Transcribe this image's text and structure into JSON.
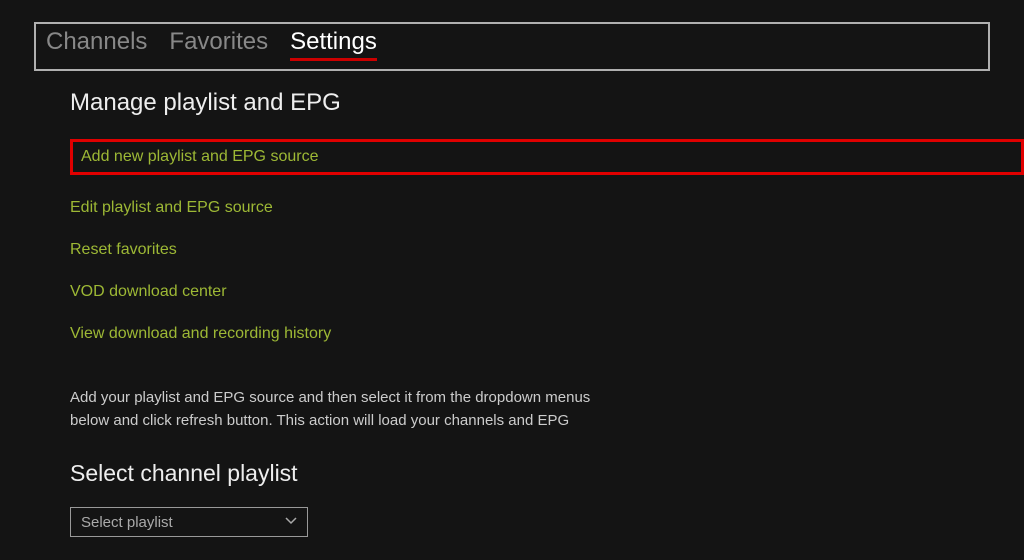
{
  "tabs": {
    "channels": "Channels",
    "favorites": "Favorites",
    "settings": "Settings"
  },
  "sections": {
    "manage_title": "Manage playlist and EPG",
    "options": {
      "add_new": "Add new playlist and EPG source",
      "edit": "Edit playlist and EPG source",
      "reset": "Reset favorites",
      "vod": "VOD download center",
      "history": "View download and recording history"
    },
    "description": "Add your playlist and EPG source and then select it from the dropdown menus below and click refresh button. This action will load your channels and EPG",
    "select_title": "Select channel playlist",
    "dropdown_label": "Select playlist"
  }
}
